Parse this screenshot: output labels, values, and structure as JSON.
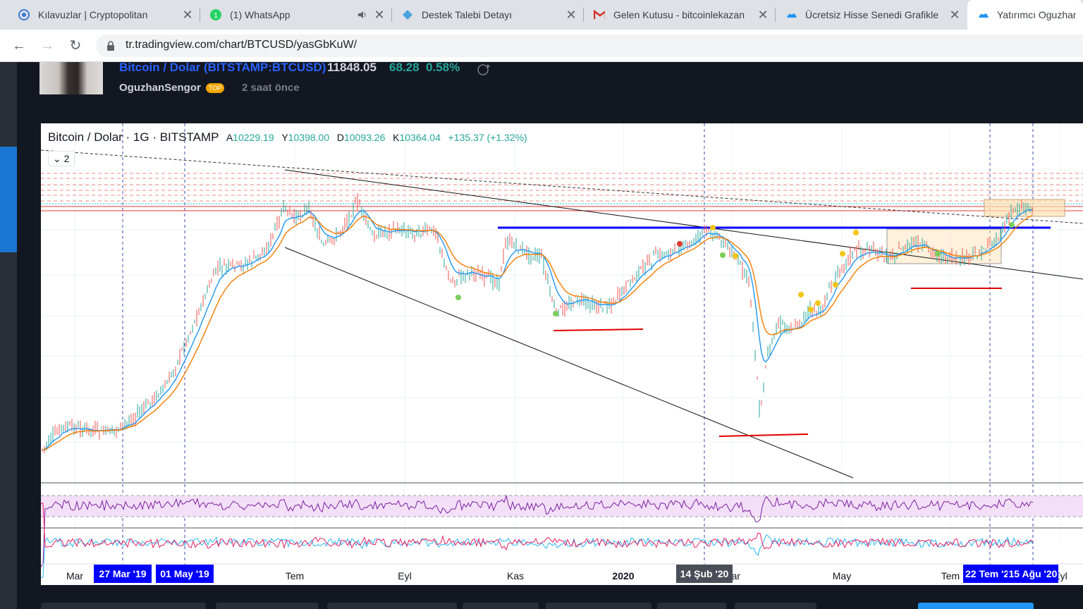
{
  "tabs": [
    {
      "title": "Kılavuzlar | Cryptopolitan",
      "icon": "cryptopolitan-icon",
      "close": "✕"
    },
    {
      "title": "(1) WhatsApp",
      "icon": "whatsapp-icon",
      "close": "✕",
      "badge": "1"
    },
    {
      "title": "Destek Talebi Detayı",
      "icon": "diamond-icon",
      "close": "✕"
    },
    {
      "title": "Gelen Kutusu - bitcoinlekazan",
      "icon": "gmail-icon",
      "close": "✕"
    },
    {
      "title": "Ücretsiz Hisse Senedi Grafikle",
      "icon": "tradingview-icon",
      "close": "✕"
    },
    {
      "title": "Yatırımcı OguzhanS",
      "icon": "tradingview-icon",
      "close": ""
    }
  ],
  "address": {
    "url": "tr.tradingview.com/chart/BTCUSD/yasGbKuW/"
  },
  "idea": {
    "symbol_name": "Bitcoin / Dolar",
    "symbol_code": "(BITSTAMP:BTCUSD)",
    "price": "11848.05",
    "change": "68.28",
    "change_pct": "0.58%",
    "author": "OguzhanSengor",
    "author_badge": "TOP",
    "posted": "2 saat önce"
  },
  "chart": {
    "title": "Bitcoin / Dolar · 1G · BITSTAMP",
    "o_label": "A",
    "o": "10229.19",
    "h_label": "Y",
    "h": "10398.00",
    "l_label": "D",
    "l": "10093.26",
    "c_label": "K",
    "c": "10364.04",
    "change": "+135.37 (+1.32%)",
    "layers": "2",
    "x_ticks": [
      "Mar",
      "Tem",
      "Eyl",
      "Kas",
      "2020",
      "Mar",
      "May",
      "Tem",
      "Eyl"
    ],
    "date_markers": [
      "27 Mar '19",
      "01 May '19",
      "14 Şub '20",
      "22 Tem '20",
      "15 Ağu '20"
    ],
    "colors": {
      "up": "#26a69a",
      "down": "#ef5350",
      "ema_fast": "#2196f3",
      "ema_slow": "#f57c00",
      "support": "#e00000",
      "resistance": "#0000ff",
      "rsi": "#7b1fa2",
      "rsi_band": "#f3e0f8"
    }
  }
}
